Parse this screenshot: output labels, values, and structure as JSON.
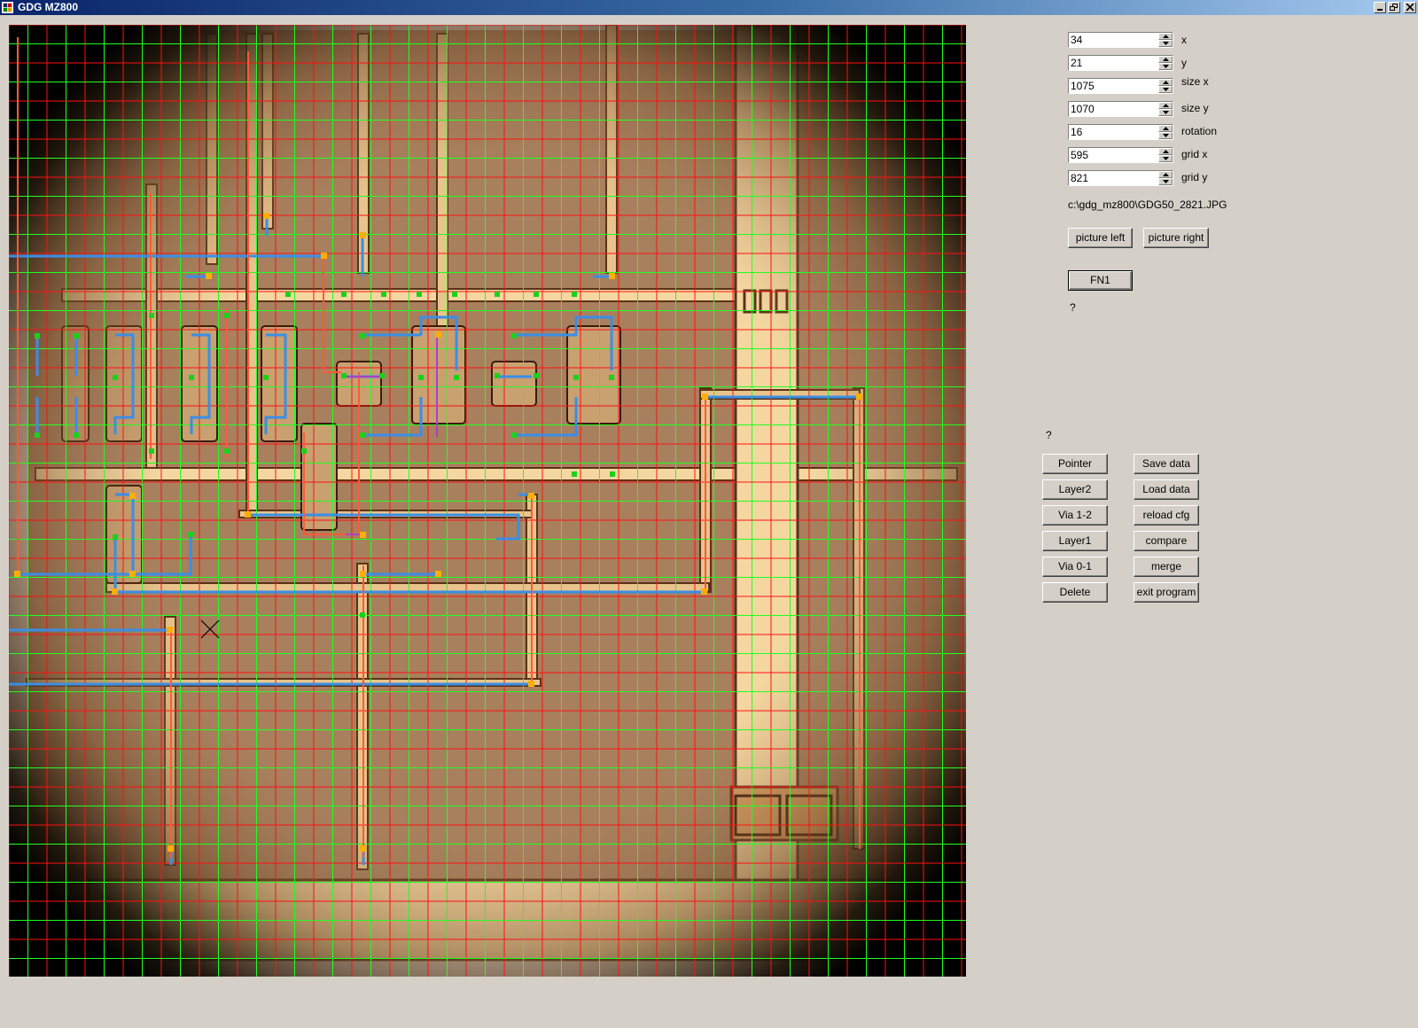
{
  "window": {
    "title": "GDG MZ800",
    "icon": "app-icon"
  },
  "controls": {
    "fields": [
      {
        "value": "34",
        "label": "x"
      },
      {
        "value": "21",
        "label": "y"
      },
      {
        "value": "1075",
        "label": "size x"
      },
      {
        "value": "1070",
        "label": "size y"
      },
      {
        "value": "16",
        "label": "rotation"
      },
      {
        "value": "595",
        "label": "grid x"
      },
      {
        "value": "821",
        "label": "grid y"
      }
    ],
    "file_path": "c:\\gdg_mz800\\GDG50_2821.JPG",
    "picture_left": "picture left",
    "picture_right": "picture right",
    "fn1": "FN1",
    "status1": "?",
    "status2": "?",
    "tools": [
      "Pointer",
      "Layer2",
      "Via 1-2",
      "Layer1",
      "Via 0-1",
      "Delete"
    ],
    "actions": [
      "Save data",
      "Load data",
      "reload cfg",
      "compare",
      "merge",
      "exit program"
    ]
  },
  "colors": {
    "grid_red": "#ff1010",
    "grid_green": "#20ff20",
    "trace_blue": "#3a8ee6",
    "die_background": "#a8805e",
    "metal_light": "#f4d7a0",
    "via_orange": "#ffae00",
    "via_green": "#19d219"
  }
}
